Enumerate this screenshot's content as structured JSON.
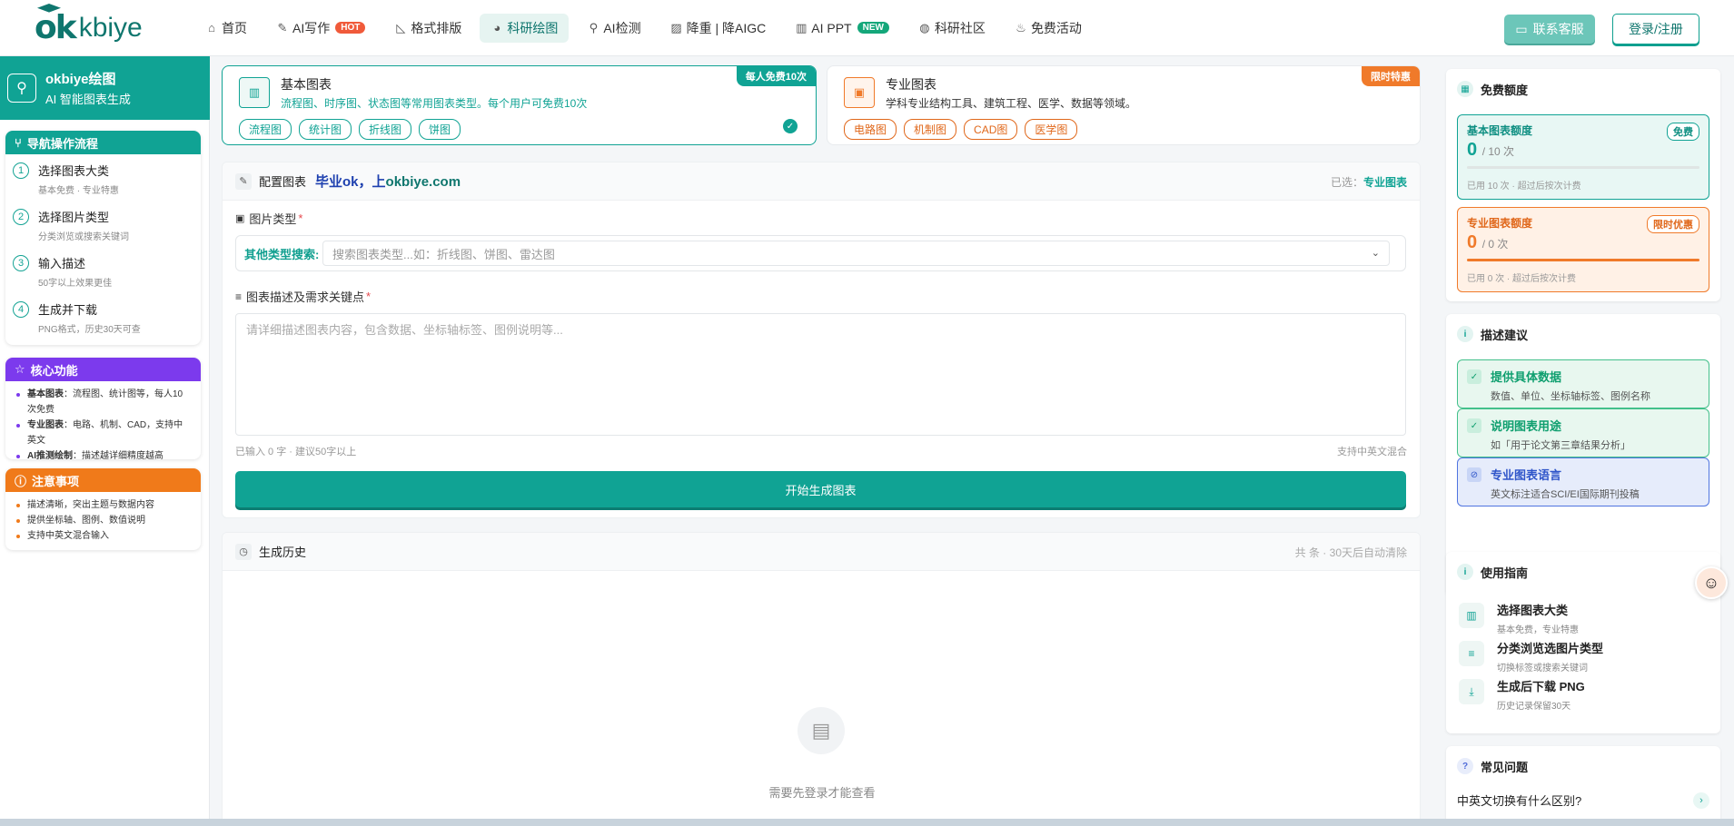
{
  "header": {
    "logo_ok": "ok",
    "logo_rest": "kbiye",
    "nav": [
      {
        "label": "首页",
        "icon": "home-icon",
        "glyph": "⌂"
      },
      {
        "label": "AI写作",
        "icon": "pen-icon",
        "glyph": "✎",
        "badge": "HOT"
      },
      {
        "label": "格式排版",
        "icon": "ruler-icon",
        "glyph": "◺"
      },
      {
        "label": "科研绘图",
        "icon": "palette-icon",
        "glyph": "◕",
        "active": true
      },
      {
        "label": "AI检测",
        "icon": "search-icon",
        "glyph": "⚲"
      },
      {
        "label": "降重 | 降AIGC",
        "icon": "edit-square-icon",
        "glyph": "▨"
      },
      {
        "label": "AI PPT",
        "icon": "chart-icon",
        "glyph": "▥",
        "badge": "NEW"
      },
      {
        "label": "科研社区",
        "icon": "globe-icon",
        "glyph": "◍"
      },
      {
        "label": "免费活动",
        "icon": "medal-icon",
        "glyph": "♨"
      }
    ],
    "contact_label": "联系客服",
    "login_label": "登录/注册"
  },
  "sidebar": {
    "brand_title": "okbiye绘图",
    "brand_subtitle": "AI 智能图表生成",
    "nav_title": "导航操作流程",
    "steps": [
      {
        "num": "1",
        "title": "选择图表大类",
        "desc": "基本免费 · 专业特惠"
      },
      {
        "num": "2",
        "title": "选择图片类型",
        "desc": "分类浏览或搜索关键词"
      },
      {
        "num": "3",
        "title": "输入描述",
        "desc": "50字以上效果更佳"
      },
      {
        "num": "4",
        "title": "生成并下载",
        "desc": "PNG格式，历史30天可查"
      }
    ],
    "core_title": "核心功能",
    "core": [
      {
        "bold": "基本图表",
        "text": "：流程图、统计图等，每人10次免费"
      },
      {
        "bold": "专业图表",
        "text": "：电路、机制、CAD，支持中英文"
      },
      {
        "bold": "AI推测绘制",
        "text": "：描述越详细精度越高"
      }
    ],
    "notice_title": "注意事项",
    "notices": [
      "描述清晰，突出主题与数据内容",
      "提供坐标轴、图例、数值说明",
      "支持中英文混合输入"
    ]
  },
  "types": {
    "basic": {
      "title": "基本图表",
      "desc": "流程图、时序图、状态图等常用图表类型。每个用户可免费10次",
      "corner": "每人免费10次",
      "chips": [
        "流程图",
        "统计图",
        "折线图",
        "饼图"
      ]
    },
    "pro": {
      "title": "专业图表",
      "desc": "学科专业结构工具、建筑工程、医学、数据等领域。",
      "corner": "限时特惠",
      "chips": [
        "电路图",
        "机制图",
        "CAD图",
        "医学图"
      ]
    }
  },
  "config": {
    "title": "配置图表",
    "slogan_a": "毕业ok，上",
    "slogan_b": "okbiye.com",
    "selected_label": "已选：",
    "selected_value": "专业图表",
    "image_type_label": "图片类型",
    "search_label": "其他类型搜索:",
    "search_placeholder": "搜索图表类型...如：折线图、饼图、雷达图",
    "desc_label": "图表描述及需求关键点",
    "desc_placeholder": "请详细描述图表内容，包含数据、坐标轴标签、图例说明等...",
    "count_text": "已输入 0 字 · 建议50字以上",
    "lang_text": "支持中英文混合",
    "generate_label": "开始生成图表"
  },
  "history": {
    "title": "生成历史",
    "meta": "共 条 · 30天后自动清除",
    "empty_text": "需要先登录才能查看"
  },
  "quota": {
    "title": "免费额度",
    "basic": {
      "title": "基本图表额度",
      "badge": "免费",
      "num": "0",
      "of": "/ 10 次",
      "foot": "已用 10 次 · 超过后按次计费",
      "fill": 0
    },
    "pro": {
      "title": "专业图表额度",
      "badge": "限时优惠",
      "num": "0",
      "of": "/ 0 次",
      "foot": "已用 0 次 · 超过后按次计费",
      "fill": 1
    }
  },
  "tips": {
    "title": "描述建议",
    "items": [
      {
        "title": "提供具体数据",
        "desc": "数值、单位、坐标轴标签、图例名称"
      },
      {
        "title": "说明图表用途",
        "desc": "如「用于论文第三章结果分析」"
      },
      {
        "title": "专业图表语言",
        "desc": "英文标注适合SCI/EI国际期刊投稿"
      }
    ]
  },
  "guide": {
    "title": "使用指南",
    "items": [
      {
        "title": "选择图表大类",
        "desc": "基本免费，专业特惠"
      },
      {
        "title": "分类浏览选图片类型",
        "desc": "切换标签或搜索关键词"
      },
      {
        "title": "生成后下载 PNG",
        "desc": "历史记录保留30天"
      }
    ]
  },
  "faq": {
    "title": "常见问题",
    "q1": "中英文切换有什么区别?"
  },
  "colors": {
    "accent": "#10a394",
    "orange": "#f07a2a",
    "purple": "#7c3aed"
  }
}
